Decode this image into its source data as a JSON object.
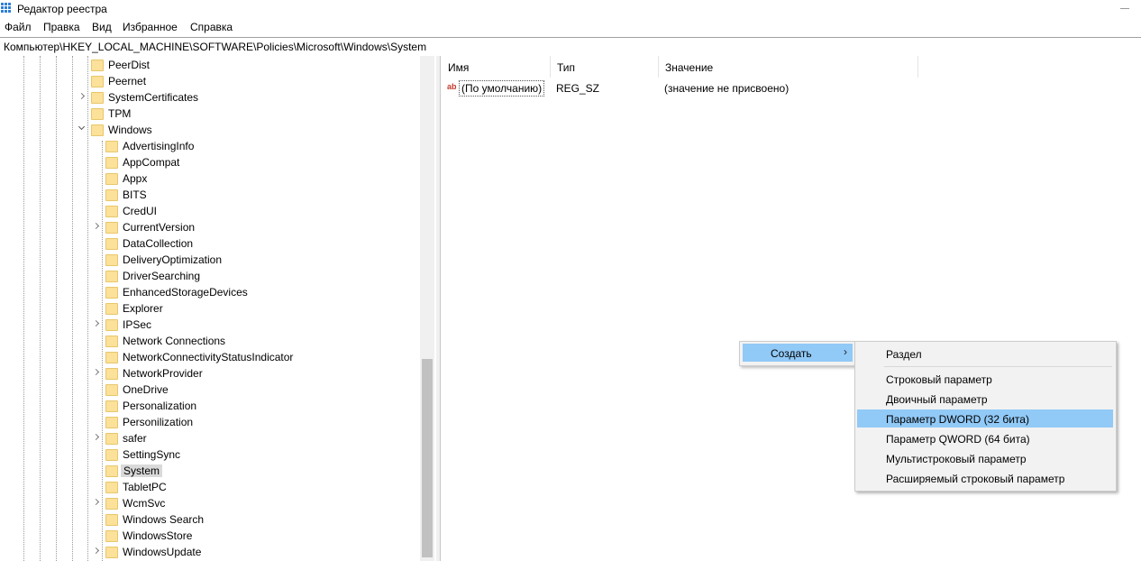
{
  "window": {
    "title": "Редактор реестра"
  },
  "menubar": [
    "Файл",
    "Правка",
    "Вид",
    "Избранное",
    "Справка"
  ],
  "address": "Компьютер\\HKEY_LOCAL_MACHINE\\SOFTWARE\\Policies\\Microsoft\\Windows\\System",
  "tree": {
    "level1": [
      {
        "label": "PeerDist",
        "expander": "none"
      },
      {
        "label": "Peernet",
        "expander": "none"
      },
      {
        "label": "SystemCertificates",
        "expander": "collapsed"
      },
      {
        "label": "TPM",
        "expander": "none"
      },
      {
        "label": "Windows",
        "expander": "open"
      }
    ],
    "level2": [
      {
        "label": "AdvertisingInfo",
        "expander": "none"
      },
      {
        "label": "AppCompat",
        "expander": "none"
      },
      {
        "label": "Appx",
        "expander": "none"
      },
      {
        "label": "BITS",
        "expander": "none"
      },
      {
        "label": "CredUI",
        "expander": "none"
      },
      {
        "label": "CurrentVersion",
        "expander": "collapsed"
      },
      {
        "label": "DataCollection",
        "expander": "none"
      },
      {
        "label": "DeliveryOptimization",
        "expander": "none"
      },
      {
        "label": "DriverSearching",
        "expander": "none"
      },
      {
        "label": "EnhancedStorageDevices",
        "expander": "none"
      },
      {
        "label": "Explorer",
        "expander": "none"
      },
      {
        "label": "IPSec",
        "expander": "collapsed"
      },
      {
        "label": "Network Connections",
        "expander": "none"
      },
      {
        "label": "NetworkConnectivityStatusIndicator",
        "expander": "none"
      },
      {
        "label": "NetworkProvider",
        "expander": "collapsed"
      },
      {
        "label": "OneDrive",
        "expander": "none"
      },
      {
        "label": "Personalization",
        "expander": "none"
      },
      {
        "label": "Personilization",
        "expander": "none"
      },
      {
        "label": "safer",
        "expander": "collapsed"
      },
      {
        "label": "SettingSync",
        "expander": "none"
      },
      {
        "label": "System",
        "expander": "none",
        "selected": true
      },
      {
        "label": "TabletPC",
        "expander": "none"
      },
      {
        "label": "WcmSvc",
        "expander": "collapsed"
      },
      {
        "label": "Windows Search",
        "expander": "none"
      },
      {
        "label": "WindowsStore",
        "expander": "none"
      },
      {
        "label": "WindowsUpdate",
        "expander": "collapsed"
      }
    ]
  },
  "list": {
    "columns": [
      "Имя",
      "Тип",
      "Значение"
    ],
    "rows": [
      {
        "icon": "string-value-icon",
        "name": "(По умолчанию)",
        "type": "REG_SZ",
        "value": "(значение не присвоено)"
      }
    ]
  },
  "context_menu": {
    "create_label": "Создать",
    "arrow": "›",
    "submenu": [
      "Раздел",
      "Строковый параметр",
      "Двоичный параметр",
      "Параметр DWORD (32 бита)",
      "Параметр QWORD (64 бита)",
      "Мультистроковый параметр",
      "Расширяемый строковый параметр"
    ],
    "highlighted": "Параметр DWORD (32 бита)"
  },
  "colors": {
    "highlight": "#91c9f7",
    "folder": "#fbe19a",
    "selection": "#d9d9d9"
  }
}
